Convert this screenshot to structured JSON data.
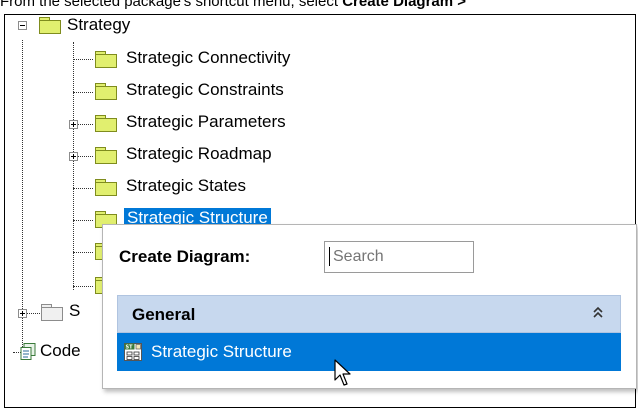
{
  "instruction": {
    "prefix": "From the selected package's shortcut menu, select ",
    "bold": "Create Diagram > "
  },
  "tree": {
    "root_label": "Strategy",
    "children": [
      {
        "label": "Strategic Connectivity",
        "expandable": false
      },
      {
        "label": "Strategic Constraints",
        "expandable": false
      },
      {
        "label": "Strategic Parameters",
        "expandable": true
      },
      {
        "label": "Strategic Roadmap",
        "expandable": true
      },
      {
        "label": "Strategic States",
        "expandable": false
      },
      {
        "label": "Strategic Structure",
        "expandable": false,
        "selected": true
      }
    ],
    "partial_sibling_label": "S",
    "code_label": "Code"
  },
  "popup": {
    "title": "Create Diagram:",
    "search_placeholder": "Search",
    "group": {
      "label": "General",
      "items": [
        {
          "label": "Strategic Structure",
          "icon": "strategic-structure-diagram-icon"
        }
      ]
    }
  },
  "colors": {
    "selection": "#0078d7",
    "folder_fill": "#e1ef6f",
    "group_header": "#c7d8ee"
  }
}
